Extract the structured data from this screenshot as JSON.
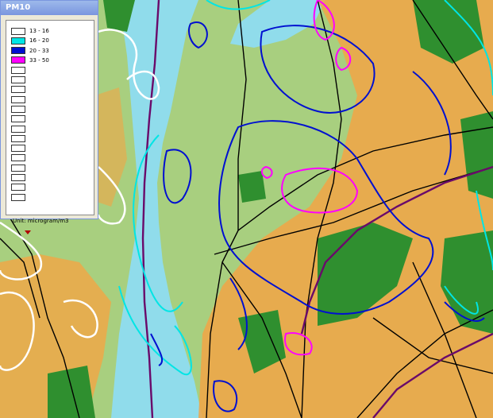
{
  "legend": {
    "title": "PM10",
    "classes": [
      {
        "label": "13 - 16",
        "color": "#ffffff"
      },
      {
        "label": "16 - 20",
        "color": "#00e5e5"
      },
      {
        "label": "20 - 33",
        "color": "#0010d0"
      },
      {
        "label": "33 - 50",
        "color": "#ff00ff"
      }
    ],
    "empty_slots": 14,
    "unit": "Unit: microgram/m3",
    "expand_icon": "triangle-down-icon"
  },
  "map": {
    "colors": {
      "water": "#90dceb",
      "grass": "#a8cf7f",
      "forest": "#2f8f2f",
      "urban": "#f2a545",
      "road": "#000000",
      "rail": "#6a0a6a"
    }
  }
}
